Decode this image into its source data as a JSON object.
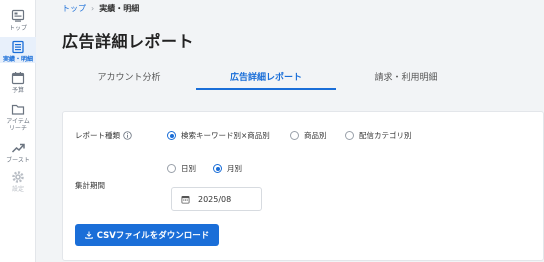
{
  "sidebar": {
    "items": [
      {
        "label": "トップ",
        "icon": "dashboard-icon"
      },
      {
        "label": "実績・明細",
        "icon": "document-list-icon"
      },
      {
        "label": "予算",
        "icon": "calendar-icon"
      },
      {
        "label": "アイテム\nリーチ",
        "icon": "folder-icon"
      },
      {
        "label": "ブースト",
        "icon": "trend-up-icon"
      },
      {
        "label": "設定",
        "icon": "gear-icon"
      }
    ]
  },
  "breadcrumb": {
    "home": "トップ",
    "current": "実績・明細"
  },
  "page_title": "広告詳細レポート",
  "tabs": [
    {
      "label": "アカウント分析"
    },
    {
      "label": "広告詳細レポート"
    },
    {
      "label": "請求・利用明細"
    }
  ],
  "form": {
    "report_type_label": "レポート種類",
    "report_type_options": [
      "検索キーワード別×商品別",
      "商品別",
      "配信カテゴリ別"
    ],
    "report_type_selected": "検索キーワード別×商品別",
    "period_label": "集計期間",
    "period_options": [
      "日別",
      "月別"
    ],
    "period_selected": "月別",
    "date_value": "2025/08",
    "download_label": "CSVファイルをダウンロード"
  },
  "colors": {
    "accent": "#1a6ed8",
    "background": "#f2f4f6"
  }
}
